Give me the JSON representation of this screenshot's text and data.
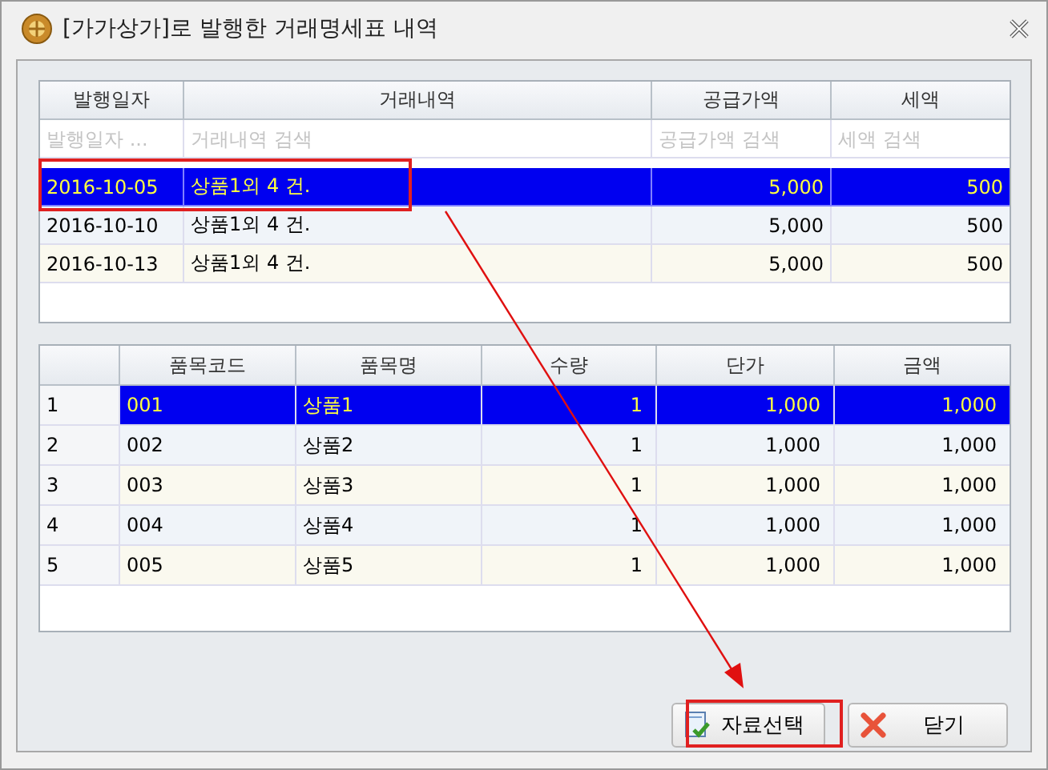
{
  "window": {
    "title": "[가가상가]로 발행한 거래명세표 내역"
  },
  "invoices": {
    "columns": [
      "발행일자",
      "거래내역",
      "공급가액",
      "세액"
    ],
    "filters": [
      {
        "placeholder": "발행일자 ..."
      },
      {
        "placeholder": "거래내역 검색"
      },
      {
        "placeholder": "공급가액 검색"
      },
      {
        "placeholder": "세액 검색"
      }
    ],
    "rows": [
      {
        "cells": [
          "2016-10-05",
          "상품1외 4 건.",
          "5,000",
          "500"
        ],
        "selected": true
      },
      {
        "cells": [
          "2016-10-10",
          "상품1외 4 건.",
          "5,000",
          "500"
        ],
        "selected": false
      },
      {
        "cells": [
          "2016-10-13",
          "상품1외 4 건.",
          "5,000",
          "500"
        ],
        "selected": false
      }
    ]
  },
  "items": {
    "columns": [
      "",
      "품목코드",
      "품목명",
      "수량",
      "단가",
      "금액"
    ],
    "rows": [
      {
        "cells": [
          "1",
          "001",
          "상품1",
          "1",
          "1,000",
          "1,000"
        ],
        "selected": true
      },
      {
        "cells": [
          "2",
          "002",
          "상품2",
          "1",
          "1,000",
          "1,000"
        ],
        "selected": false
      },
      {
        "cells": [
          "3",
          "003",
          "상품3",
          "1",
          "1,000",
          "1,000"
        ],
        "selected": false
      },
      {
        "cells": [
          "4",
          "004",
          "상품4",
          "1",
          "1,000",
          "1,000"
        ],
        "selected": false
      },
      {
        "cells": [
          "5",
          "005",
          "상품5",
          "1",
          "1,000",
          "1,000"
        ],
        "selected": false
      }
    ]
  },
  "buttons": [
    {
      "label": "자료선택",
      "kind": "select"
    },
    {
      "label": "닫기",
      "kind": "close"
    }
  ]
}
